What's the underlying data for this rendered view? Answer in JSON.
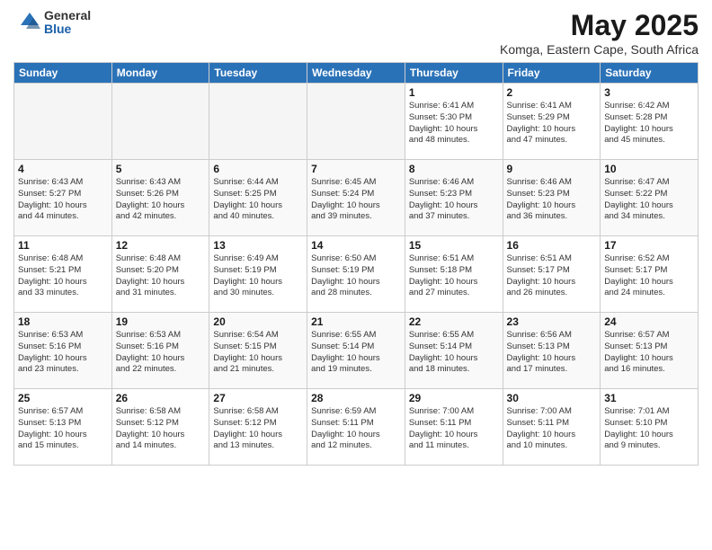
{
  "header": {
    "logo_general": "General",
    "logo_blue": "Blue",
    "month": "May 2025",
    "location": "Komga, Eastern Cape, South Africa"
  },
  "days_of_week": [
    "Sunday",
    "Monday",
    "Tuesday",
    "Wednesday",
    "Thursday",
    "Friday",
    "Saturday"
  ],
  "weeks": [
    [
      {
        "day": "",
        "info": ""
      },
      {
        "day": "",
        "info": ""
      },
      {
        "day": "",
        "info": ""
      },
      {
        "day": "",
        "info": ""
      },
      {
        "day": "1",
        "info": "Sunrise: 6:41 AM\nSunset: 5:30 PM\nDaylight: 10 hours\nand 48 minutes."
      },
      {
        "day": "2",
        "info": "Sunrise: 6:41 AM\nSunset: 5:29 PM\nDaylight: 10 hours\nand 47 minutes."
      },
      {
        "day": "3",
        "info": "Sunrise: 6:42 AM\nSunset: 5:28 PM\nDaylight: 10 hours\nand 45 minutes."
      }
    ],
    [
      {
        "day": "4",
        "info": "Sunrise: 6:43 AM\nSunset: 5:27 PM\nDaylight: 10 hours\nand 44 minutes."
      },
      {
        "day": "5",
        "info": "Sunrise: 6:43 AM\nSunset: 5:26 PM\nDaylight: 10 hours\nand 42 minutes."
      },
      {
        "day": "6",
        "info": "Sunrise: 6:44 AM\nSunset: 5:25 PM\nDaylight: 10 hours\nand 40 minutes."
      },
      {
        "day": "7",
        "info": "Sunrise: 6:45 AM\nSunset: 5:24 PM\nDaylight: 10 hours\nand 39 minutes."
      },
      {
        "day": "8",
        "info": "Sunrise: 6:46 AM\nSunset: 5:23 PM\nDaylight: 10 hours\nand 37 minutes."
      },
      {
        "day": "9",
        "info": "Sunrise: 6:46 AM\nSunset: 5:23 PM\nDaylight: 10 hours\nand 36 minutes."
      },
      {
        "day": "10",
        "info": "Sunrise: 6:47 AM\nSunset: 5:22 PM\nDaylight: 10 hours\nand 34 minutes."
      }
    ],
    [
      {
        "day": "11",
        "info": "Sunrise: 6:48 AM\nSunset: 5:21 PM\nDaylight: 10 hours\nand 33 minutes."
      },
      {
        "day": "12",
        "info": "Sunrise: 6:48 AM\nSunset: 5:20 PM\nDaylight: 10 hours\nand 31 minutes."
      },
      {
        "day": "13",
        "info": "Sunrise: 6:49 AM\nSunset: 5:19 PM\nDaylight: 10 hours\nand 30 minutes."
      },
      {
        "day": "14",
        "info": "Sunrise: 6:50 AM\nSunset: 5:19 PM\nDaylight: 10 hours\nand 28 minutes."
      },
      {
        "day": "15",
        "info": "Sunrise: 6:51 AM\nSunset: 5:18 PM\nDaylight: 10 hours\nand 27 minutes."
      },
      {
        "day": "16",
        "info": "Sunrise: 6:51 AM\nSunset: 5:17 PM\nDaylight: 10 hours\nand 26 minutes."
      },
      {
        "day": "17",
        "info": "Sunrise: 6:52 AM\nSunset: 5:17 PM\nDaylight: 10 hours\nand 24 minutes."
      }
    ],
    [
      {
        "day": "18",
        "info": "Sunrise: 6:53 AM\nSunset: 5:16 PM\nDaylight: 10 hours\nand 23 minutes."
      },
      {
        "day": "19",
        "info": "Sunrise: 6:53 AM\nSunset: 5:16 PM\nDaylight: 10 hours\nand 22 minutes."
      },
      {
        "day": "20",
        "info": "Sunrise: 6:54 AM\nSunset: 5:15 PM\nDaylight: 10 hours\nand 21 minutes."
      },
      {
        "day": "21",
        "info": "Sunrise: 6:55 AM\nSunset: 5:14 PM\nDaylight: 10 hours\nand 19 minutes."
      },
      {
        "day": "22",
        "info": "Sunrise: 6:55 AM\nSunset: 5:14 PM\nDaylight: 10 hours\nand 18 minutes."
      },
      {
        "day": "23",
        "info": "Sunrise: 6:56 AM\nSunset: 5:13 PM\nDaylight: 10 hours\nand 17 minutes."
      },
      {
        "day": "24",
        "info": "Sunrise: 6:57 AM\nSunset: 5:13 PM\nDaylight: 10 hours\nand 16 minutes."
      }
    ],
    [
      {
        "day": "25",
        "info": "Sunrise: 6:57 AM\nSunset: 5:13 PM\nDaylight: 10 hours\nand 15 minutes."
      },
      {
        "day": "26",
        "info": "Sunrise: 6:58 AM\nSunset: 5:12 PM\nDaylight: 10 hours\nand 14 minutes."
      },
      {
        "day": "27",
        "info": "Sunrise: 6:58 AM\nSunset: 5:12 PM\nDaylight: 10 hours\nand 13 minutes."
      },
      {
        "day": "28",
        "info": "Sunrise: 6:59 AM\nSunset: 5:11 PM\nDaylight: 10 hours\nand 12 minutes."
      },
      {
        "day": "29",
        "info": "Sunrise: 7:00 AM\nSunset: 5:11 PM\nDaylight: 10 hours\nand 11 minutes."
      },
      {
        "day": "30",
        "info": "Sunrise: 7:00 AM\nSunset: 5:11 PM\nDaylight: 10 hours\nand 10 minutes."
      },
      {
        "day": "31",
        "info": "Sunrise: 7:01 AM\nSunset: 5:10 PM\nDaylight: 10 hours\nand 9 minutes."
      }
    ]
  ]
}
